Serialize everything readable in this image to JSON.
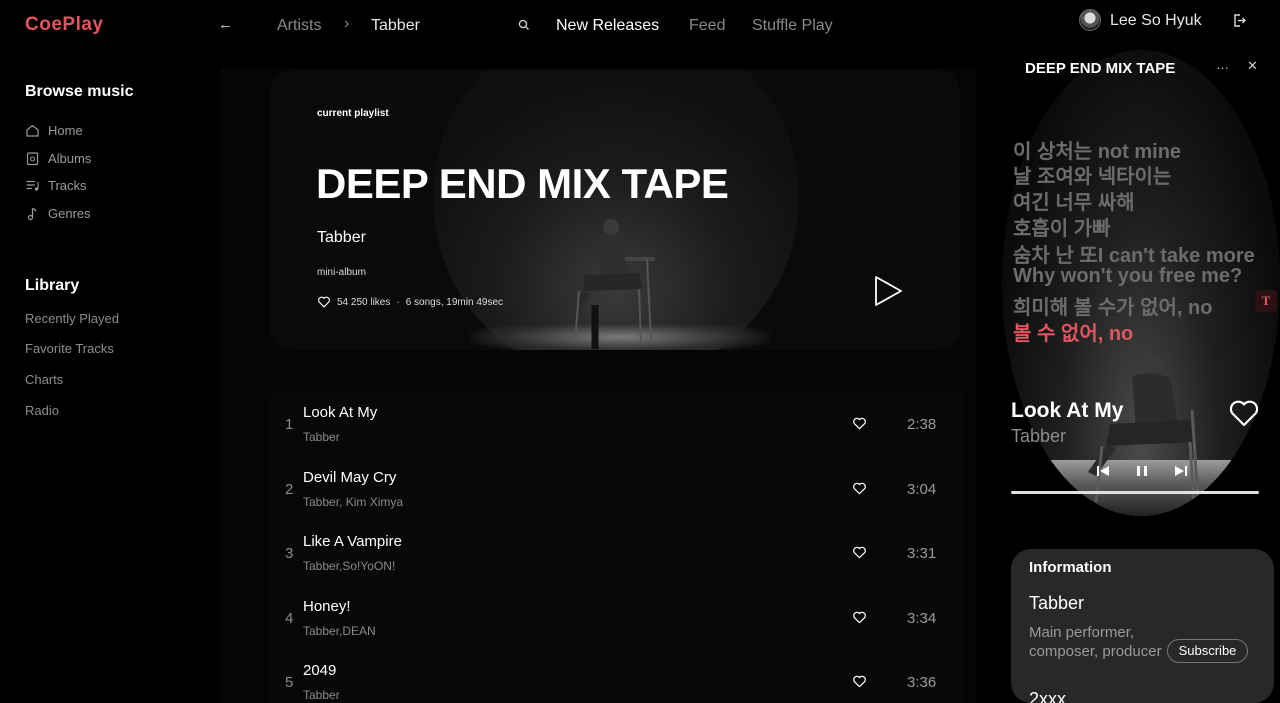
{
  "header": {
    "logo": "CoePlay",
    "breadcrumb": [
      "Artists",
      "Tabber"
    ],
    "breadcrumb_separator": "›",
    "back_icon": "←",
    "nav": [
      "New Releases",
      "Feed",
      "Stuffle Play"
    ],
    "user": "Lee So Hyuk"
  },
  "sidebar": {
    "browse_title": "Browse music",
    "browse_items": [
      {
        "label": "Home",
        "icon": "home-icon"
      },
      {
        "label": "Albums",
        "icon": "albums-icon"
      },
      {
        "label": "Tracks",
        "icon": "tracks-icon"
      },
      {
        "label": "Genres",
        "icon": "genres-icon"
      }
    ],
    "library_title": "Library",
    "library_items": [
      "Recently Played",
      "Favorite Tracks",
      "Charts",
      "Radio"
    ]
  },
  "hero": {
    "tag": "current playlist",
    "title": "DEEP END MIX TAPE",
    "artist": "Tabber",
    "type": "mini-album",
    "likes": "54 250 likes",
    "separator": "·",
    "summary": "6 songs, 19min 49sec"
  },
  "tracks": [
    {
      "num": "1",
      "title": "Look At My",
      "artist": "Tabber",
      "duration": "2:38"
    },
    {
      "num": "2",
      "title": "Devil May Cry",
      "artist": "Tabber, Kim Ximya",
      "duration": "3:04"
    },
    {
      "num": "3",
      "title": "Like A Vampire",
      "artist": "Tabber,So!YoON!",
      "duration": "3:31"
    },
    {
      "num": "4",
      "title": "Honey!",
      "artist": "Tabber,DEAN",
      "duration": "3:34"
    },
    {
      "num": "5",
      "title": "2049",
      "artist": "Tabber",
      "duration": "3:36"
    }
  ],
  "now_playing": {
    "panel_title": "DEEP END MIX TAPE",
    "more": "···",
    "close": "✕",
    "lyrics": [
      "이 상처는 not mine",
      "날 조여와 넥타이는",
      "여긴 너무 싸해",
      "호흡이 가빠",
      "숨차 난 또I can't take more",
      "Why won't you free me?",
      "희미해 볼 수가 없어, no",
      "볼 수 없어, no"
    ],
    "active_lyric_index": 7,
    "translate_button": "T",
    "song": "Look At My",
    "artist": "Tabber",
    "progress": 1.0
  },
  "information": {
    "title": "Information",
    "name": "Tabber",
    "roles": "Main performer, composer, producer",
    "subscribe": "Subscribe",
    "next_name": "2xxx"
  },
  "colors": {
    "accent": "#e2545f",
    "background": "#000000",
    "card": "#282828"
  }
}
